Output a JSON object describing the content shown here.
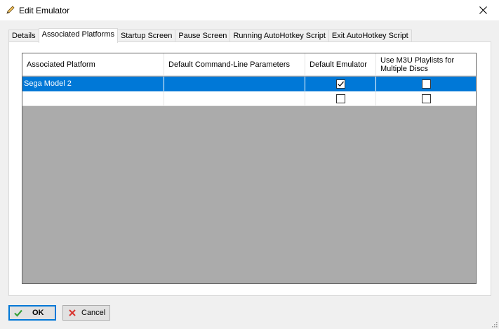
{
  "window": {
    "title": "Edit Emulator",
    "icons": {
      "title": "pencil-icon",
      "close": "close-icon"
    }
  },
  "tabs": [
    {
      "label": "Details",
      "active": false
    },
    {
      "label": "Associated Platforms",
      "active": true
    },
    {
      "label": "Startup Screen",
      "active": false
    },
    {
      "label": "Pause Screen",
      "active": false
    },
    {
      "label": "Running AutoHotkey Script",
      "active": false
    },
    {
      "label": "Exit AutoHotkey Script",
      "active": false
    }
  ],
  "grid": {
    "columns": [
      "Associated Platform",
      "Default Command-Line Parameters",
      "Default Emulator",
      "Use M3U Playlists for Multiple Discs"
    ],
    "rows": [
      {
        "platform": "Sega Model 2",
        "params": "",
        "default_emulator": true,
        "use_m3u": false,
        "selected": true
      },
      {
        "platform": "",
        "params": "",
        "default_emulator": false,
        "use_m3u": false,
        "selected": false
      }
    ]
  },
  "buttons": {
    "ok": {
      "label": "OK",
      "icon": "checkmark-icon"
    },
    "cancel": {
      "label": "Cancel",
      "icon": "x-icon"
    }
  },
  "colors": {
    "selection": "#0078d7",
    "grid_background": "#ababab",
    "ok_icon": "#3aa13a",
    "cancel_icon": "#d9332e"
  }
}
